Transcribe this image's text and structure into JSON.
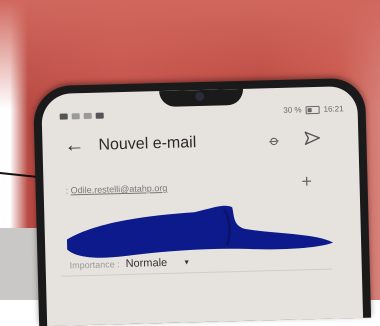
{
  "status_bar": {
    "right_text": "30 %",
    "time": "16:21"
  },
  "header": {
    "back_icon": "arrow-left-icon",
    "title": "Nouvel e-mail",
    "attach_icon": "paperclip-icon",
    "send_icon": "send-icon"
  },
  "from": {
    "prefix": ":",
    "email": "Odile.restelli@atahp.org",
    "add_icon": "plus-icon"
  },
  "importance": {
    "label": "Importance :",
    "value": "Normale",
    "dropdown_icon": "caret-down-icon"
  },
  "colors": {
    "table": "#c04e46",
    "screen": "#e6e3df",
    "redaction": "#0d1a8c"
  }
}
